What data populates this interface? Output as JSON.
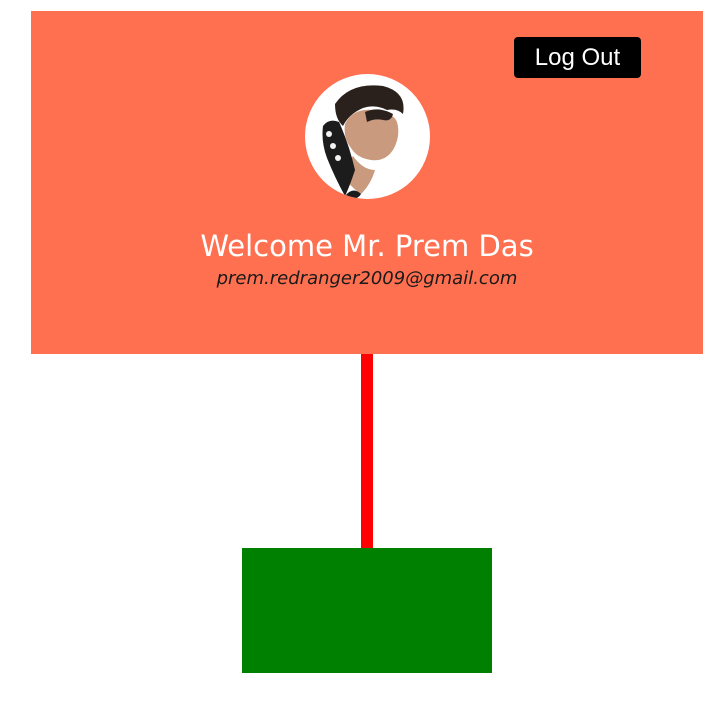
{
  "header": {
    "logout_label": "Log Out",
    "welcome_text": "Welcome Mr. Prem Das",
    "email": "prem.redranger2009@gmail.com",
    "avatar_icon": "user-portrait-icon"
  },
  "colors": {
    "card_background": "#ff7050",
    "logout_background": "#000000",
    "connector_line": "#ff0000",
    "block_fill": "#008000"
  }
}
